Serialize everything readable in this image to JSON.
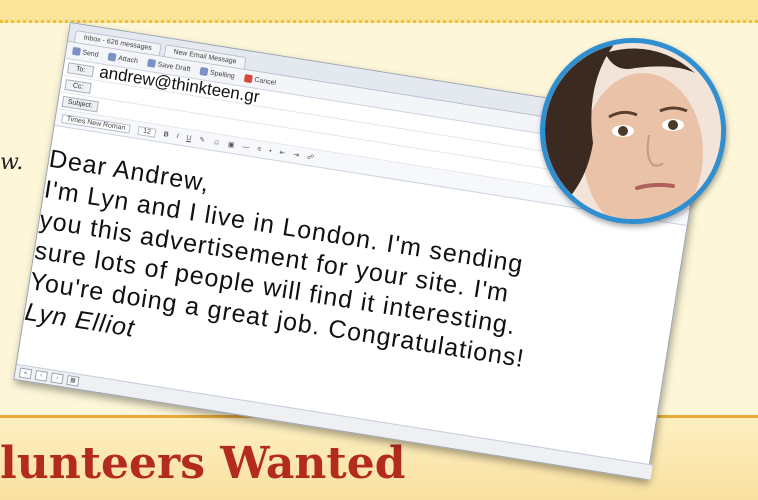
{
  "left_fragment": "w.",
  "headline": "lunteers Wanted",
  "email": {
    "tabs": [
      "Inbox - 626 messages",
      "New Email Message"
    ],
    "toolbar": [
      "Send",
      "Attach",
      "Save Draft",
      "Spelling",
      "Cancel"
    ],
    "to_label": "To:",
    "cc_label": "Cc:",
    "subject_label": "Subject:",
    "to_value": "andrew@thinkteen.gr",
    "font_name": "Times New Roman",
    "font_size": "12",
    "body_lines": [
      "Dear Andrew,",
      "I'm Lyn and I live in London. I'm sending",
      "you this advertisement for your site. I'm",
      "sure lots of people will find it interesting.",
      "You're doing a great job. Congratulations!"
    ],
    "signature": "Lyn Elliot"
  },
  "colors": {
    "headline": "#b32a1e",
    "avatar_border": "#2f8fd0",
    "top_band": "#fbe59a"
  }
}
